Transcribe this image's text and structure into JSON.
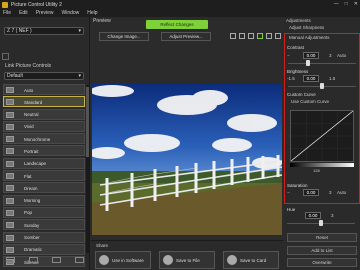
{
  "window": {
    "title": "Picture Control Utility 2"
  },
  "menu": [
    "File",
    "Edit",
    "Preview",
    "Window",
    "Help"
  ],
  "left": {
    "camera_select": "Z 7 ( NEF )",
    "list_label": "Link Picture Controls",
    "sub_select": "Default",
    "items": [
      {
        "label": "Auto"
      },
      {
        "label": "Standard",
        "selected": true
      },
      {
        "label": "Neutral"
      },
      {
        "label": "Vivid"
      },
      {
        "label": "Monochrome"
      },
      {
        "label": "Portrait"
      },
      {
        "label": "Landscape"
      },
      {
        "label": "Flat"
      },
      {
        "label": "Dream"
      },
      {
        "label": "Morning"
      },
      {
        "label": "Pop"
      },
      {
        "label": "Sunday"
      },
      {
        "label": "Somber"
      },
      {
        "label": "Dramatic"
      },
      {
        "label": "Silence"
      }
    ]
  },
  "preview": {
    "title": "Preview",
    "reflect_label": "Reflect Changes",
    "change_image_label": "Change Image...",
    "adjust_preview_label": "Adjust Preview...",
    "share_title": "Share",
    "use_in_software_label": "Use in Software",
    "save_to_file_label": "Save to File",
    "save_to_card_label": "Save to Card"
  },
  "right": {
    "adjustments_title": "Adjustments",
    "adjust_sharpness_title": "Adjust Sharpness",
    "manual_adjustments_title": "Manual Adjustments",
    "contrast_label": "Contrast",
    "contrast_value": "0.00",
    "contrast_end": "3",
    "contrast_auto": "Auto",
    "brightness_label": "Brightness",
    "brightness_value": "0.00",
    "brightness_start": "-1.5",
    "brightness_end": "1.5",
    "custom_curve_label": "Custom Curve",
    "use_custom_curve_label": "Use Custom Curve",
    "curve_readout": "128",
    "saturation_label": "Saturation",
    "saturation_value": "0.00",
    "saturation_end": "3",
    "saturation_auto": "Auto",
    "hue_label": "Hue",
    "hue_value": "0.00",
    "hue_end": "3",
    "reset_label": "Reset",
    "add_to_list_label": "Add to List",
    "overwrite_label": "Overwrite"
  },
  "colors": {
    "reflect_green": "#7fd13a",
    "highlight_red": "#d41e1e",
    "selected_gold": "#c8b34a"
  }
}
